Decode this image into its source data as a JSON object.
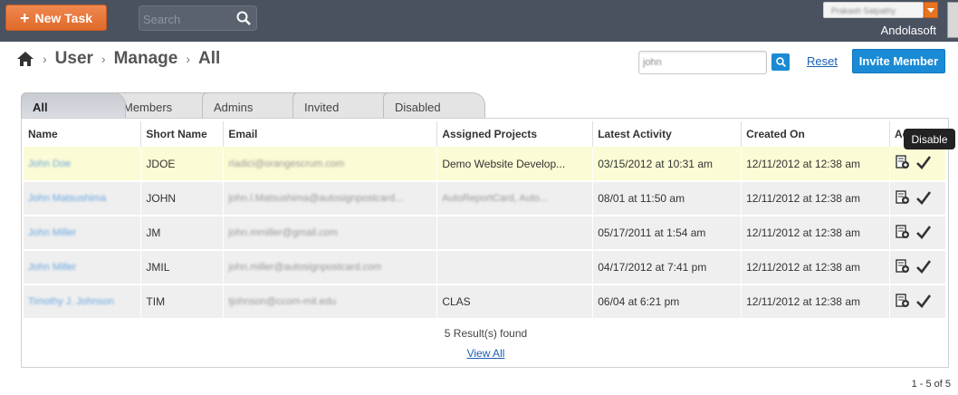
{
  "topbar": {
    "new_task_label": "New Task",
    "search_placeholder": "Search",
    "user_name": "Prakash Satpathy",
    "company": "Andolasoft"
  },
  "breadcrumb": [
    "User",
    "Manage",
    "All"
  ],
  "member_search_value": "john",
  "reset_label": "Reset",
  "invite_label": "Invite Member",
  "tabs": [
    "All",
    "Members",
    "Admins",
    "Invited",
    "Disabled"
  ],
  "table": {
    "headers": [
      "Name",
      "Short Name",
      "Email",
      "Assigned Projects",
      "Latest Activity",
      "Created On",
      "Action"
    ],
    "rows": [
      {
        "name": "John Doe",
        "short": "JDOE",
        "email": "rladici@orangescrum.com",
        "projects": "Demo Website Develop...",
        "activity": "03/15/2012 at 10:31 am",
        "created": "12/11/2012 at 12:38 am"
      },
      {
        "name": "John Matsushima",
        "short": "JOHN",
        "email": "john.l.Matsushima@autosignpostcard...",
        "projects": "AutoReportCard, Auto...",
        "activity": "08/01 at 11:50 am",
        "created": "12/11/2012 at 12:38 am"
      },
      {
        "name": "John Miller",
        "short": "JM",
        "email": "john.mmiller@gmail.com",
        "projects": "",
        "activity": "05/17/2011 at 1:54 am",
        "created": "12/11/2012 at 12:38 am"
      },
      {
        "name": "John Miller",
        "short": "JMIL",
        "email": "john.miller@autosignpostcard.com",
        "projects": "",
        "activity": "04/17/2012 at 7:41 pm",
        "created": "12/11/2012 at 12:38 am"
      },
      {
        "name": "Timothy J. Johnson",
        "short": "TIM",
        "email": "tjohnson@ccom-mit.edu",
        "projects": "CLAS",
        "activity": "06/04 at 6:21 pm",
        "created": "12/11/2012 at 12:38 am"
      }
    ]
  },
  "results_text": "5 Result(s) found",
  "view_all_label": "View All",
  "tooltip": "Disable",
  "pagination": "1 - 5 of 5",
  "colors": {
    "topbar": "#4a5260",
    "accent_orange": "#e8741f",
    "accent_blue": "#1a8ad4",
    "highlight_row": "#fbfbd5"
  }
}
